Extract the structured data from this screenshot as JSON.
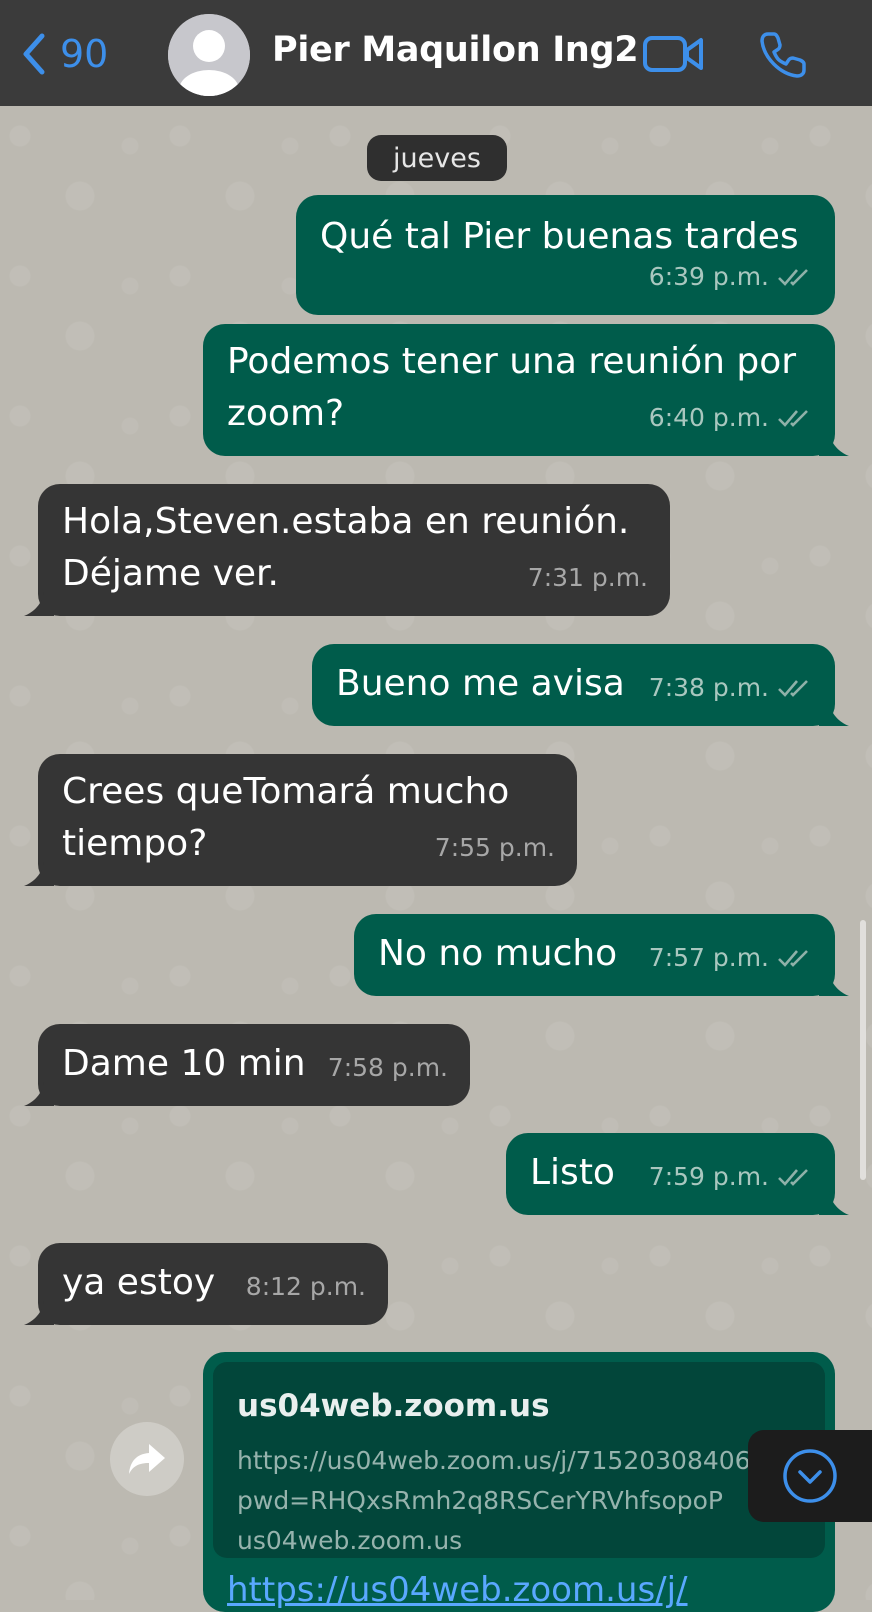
{
  "header": {
    "back_count": "90",
    "contact_name": "Pier Maquilon Ing2",
    "video_icon": "video-camera-icon",
    "phone_icon": "phone-icon",
    "accent_color": "#3d8fea"
  },
  "date_separator": "jueves",
  "messages": [
    {
      "dir": "out",
      "text": [
        "Qué tal Pier buenas tardes"
      ],
      "time": "6:39 p.m."
    },
    {
      "dir": "out",
      "text": [
        "Podemos tener una reunión por",
        "zoom?"
      ],
      "time": "6:40 p.m."
    },
    {
      "dir": "in",
      "text": [
        "Hola,Steven.estaba en reunión.",
        "Déjame ver."
      ],
      "time": "7:31 p.m."
    },
    {
      "dir": "out",
      "text": [
        "Bueno me avisa"
      ],
      "time": "7:38 p.m."
    },
    {
      "dir": "in",
      "text": [
        "Crees queTomará mucho",
        "tiempo?"
      ],
      "time": "7:55 p.m."
    },
    {
      "dir": "out",
      "text": [
        "No no mucho"
      ],
      "time": "7:57 p.m."
    },
    {
      "dir": "in",
      "text": [
        "Dame 10 min"
      ],
      "time": "7:58 p.m."
    },
    {
      "dir": "out",
      "text": [
        "Listo"
      ],
      "time": "7:59 p.m."
    },
    {
      "dir": "in",
      "text": [
        "ya estoy"
      ],
      "time": "8:12 p.m."
    }
  ],
  "link_message": {
    "preview_title": "us04web.zoom.us",
    "preview_url": "https://us04web.zoom.us/j/71520308406",
    "preview_pwd": "pwd=RHQxsRmh2q8RSCerYRVhfsopoP",
    "preview_domain": "us04web.zoom.us",
    "link_text": "https://us04web.zoom.us/j/"
  },
  "colors": {
    "outgoing_bubble": "#005c4b",
    "incoming_bubble": "#353535",
    "read_ticks": "#8fb1a9"
  }
}
